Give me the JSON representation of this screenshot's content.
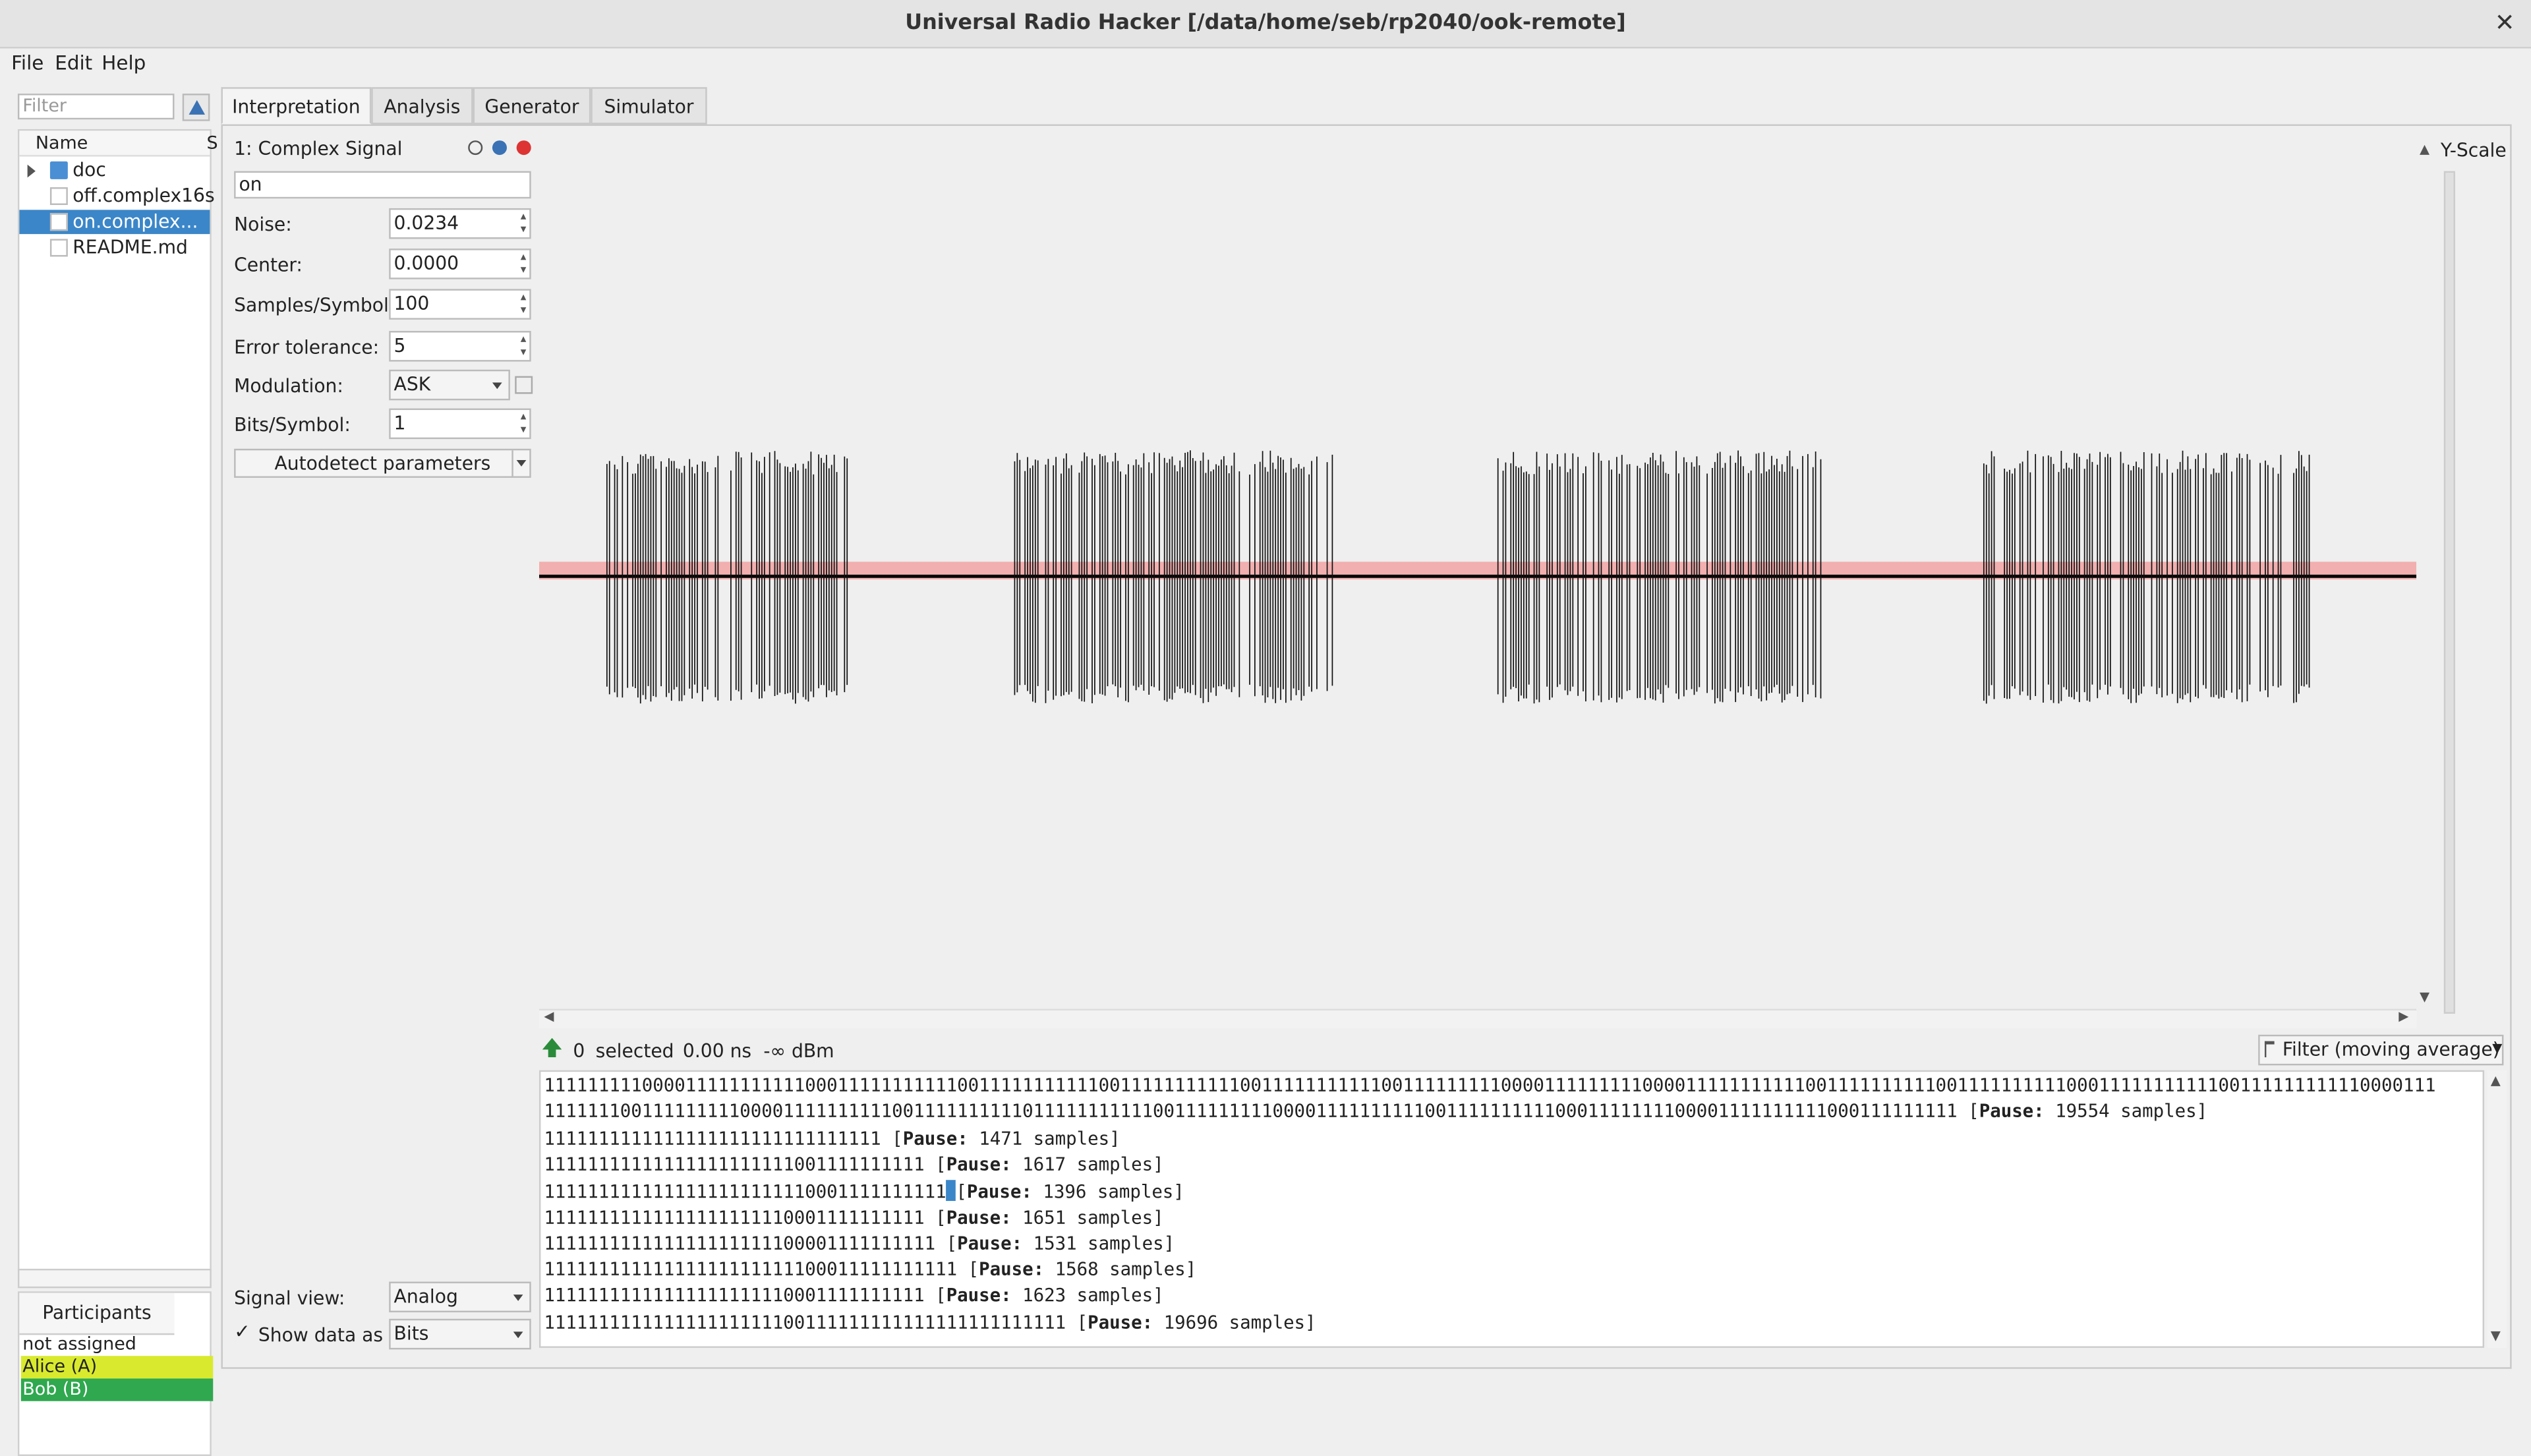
{
  "window": {
    "title": "Universal Radio Hacker [/data/home/seb/rp2040/ook-remote]",
    "close": "✕"
  },
  "menu": [
    "File",
    "Edit",
    "Help"
  ],
  "filter": {
    "placeholder": "Filter"
  },
  "tree": {
    "header": "Name",
    "header2": "S",
    "items": [
      {
        "label": "doc",
        "icon": "folder-icon"
      },
      {
        "label": "off.complex16s",
        "icon": "file-icon"
      },
      {
        "label": "on.complex...",
        "icon": "file-icon"
      },
      {
        "label": "README.md",
        "icon": "file-icon"
      }
    ]
  },
  "participants": {
    "tab": "Participants",
    "items": [
      {
        "label": "not assigned",
        "color": "#ffffff"
      },
      {
        "label": "Alice (A)",
        "color": "#d9ea2e"
      },
      {
        "label": "Bob (B)",
        "color": "#2fa84f"
      }
    ]
  },
  "tabs": [
    "Interpretation",
    "Analysis",
    "Generator",
    "Simulator"
  ],
  "signal": {
    "header": "1:  Complex Signal",
    "name": "on",
    "params": [
      {
        "label": "Noise:",
        "value": "0.0234"
      },
      {
        "label": "Center:",
        "value": "0.0000"
      },
      {
        "label": "Samples/Symbol:",
        "value": "100"
      },
      {
        "label": "Error tolerance:",
        "value": "5"
      },
      {
        "label": "Modulation:",
        "value": "ASK"
      },
      {
        "label": "Bits/Symbol:",
        "value": "1"
      }
    ],
    "autodetect": "Autodetect parameters",
    "signal_view_label": "Signal view:",
    "signal_view_value": "Analog",
    "show_data_label": "Show data as",
    "show_data_value": "Bits",
    "check": "✓"
  },
  "yscale": "Y-Scale",
  "status": {
    "selected": "0",
    "selected_label": "selected",
    "time": "0.00 ns",
    "power": "-∞ dBm",
    "filter": "Filter (moving average)"
  },
  "colors": {
    "noise_band": "#f2a3a3",
    "accent": "#3b86c8"
  },
  "data_lines": [
    {
      "bits": "111111111000011111111111000111111111110011111111111001111111111100111111111110011111111100001111111110000111111111110011111111110011111111110001111111111100111111111110000111",
      "pause": ""
    },
    {
      "bits": "1111111001111111110000111111111100111111111101111111111100111111111000011111111110011111111110001111111100001111111111000111111111 ",
      "pause": "19554 samples]"
    },
    {
      "bits": "1111111111111111111111111111111 ",
      "pause": "1471 samples]"
    },
    {
      "bits": "11111111111111111111111001111111111 ",
      "pause": "1617 samples]"
    },
    {
      "bits": "1111111111111111111111110001111111111",
      "pause": "1396 samples]",
      "cursor": true
    },
    {
      "bits": "11111111111111111111110001111111111 ",
      "pause": "1651 samples]"
    },
    {
      "bits": "111111111111111111111100001111111111 ",
      "pause": "1531 samples]"
    },
    {
      "bits": "11111111111111111111111100011111111111 ",
      "pause": "1568 samples]"
    },
    {
      "bits": "11111111111111111111110001111111111 ",
      "pause": "1623 samples]"
    },
    {
      "bits": "111111111111111111111100111111111111111111111111 ",
      "pause": "19696 samples]"
    }
  ],
  "pause_label": "Pause:"
}
